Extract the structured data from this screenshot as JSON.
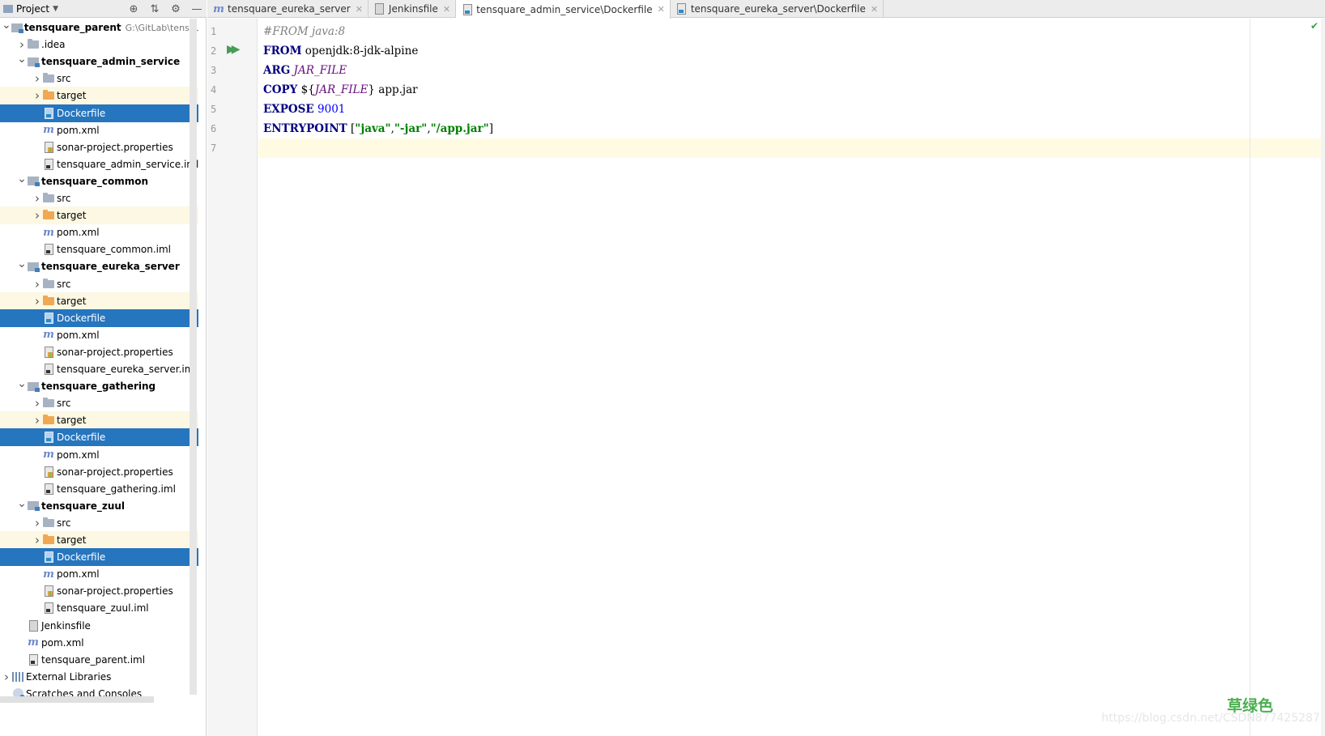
{
  "header": {
    "title": "Project"
  },
  "tree": [
    {
      "label": "tensquare_parent",
      "path": "G:\\GitLab\\tensquare_",
      "bold": true,
      "level": 0,
      "chev": "v",
      "icon": "module"
    },
    {
      "label": ".idea",
      "level": 1,
      "chev": ">",
      "icon": "folder"
    },
    {
      "label": "tensquare_admin_service",
      "bold": true,
      "level": 1,
      "chev": "v",
      "icon": "module"
    },
    {
      "label": "src",
      "level": 2,
      "chev": ">",
      "icon": "folder"
    },
    {
      "label": "target",
      "level": 2,
      "chev": ">",
      "icon": "folder-orange",
      "excluded": true
    },
    {
      "label": "Dockerfile",
      "level": 2,
      "icon": "docker",
      "selected": true
    },
    {
      "label": "pom.xml",
      "level": 2,
      "icon": "maven"
    },
    {
      "label": "sonar-project.properties",
      "level": 2,
      "icon": "props"
    },
    {
      "label": "tensquare_admin_service.iml",
      "level": 2,
      "icon": "iml"
    },
    {
      "label": "tensquare_common",
      "bold": true,
      "level": 1,
      "chev": "v",
      "icon": "module"
    },
    {
      "label": "src",
      "level": 2,
      "chev": ">",
      "icon": "folder"
    },
    {
      "label": "target",
      "level": 2,
      "chev": ">",
      "icon": "folder-orange",
      "excluded": true
    },
    {
      "label": "pom.xml",
      "level": 2,
      "icon": "maven"
    },
    {
      "label": "tensquare_common.iml",
      "level": 2,
      "icon": "iml"
    },
    {
      "label": "tensquare_eureka_server",
      "bold": true,
      "level": 1,
      "chev": "v",
      "icon": "module"
    },
    {
      "label": "src",
      "level": 2,
      "chev": ">",
      "icon": "folder"
    },
    {
      "label": "target",
      "level": 2,
      "chev": ">",
      "icon": "folder-orange",
      "excluded": true
    },
    {
      "label": "Dockerfile",
      "level": 2,
      "icon": "docker",
      "selected": true
    },
    {
      "label": "pom.xml",
      "level": 2,
      "icon": "maven"
    },
    {
      "label": "sonar-project.properties",
      "level": 2,
      "icon": "props"
    },
    {
      "label": "tensquare_eureka_server.iml",
      "level": 2,
      "icon": "iml"
    },
    {
      "label": "tensquare_gathering",
      "bold": true,
      "level": 1,
      "chev": "v",
      "icon": "module"
    },
    {
      "label": "src",
      "level": 2,
      "chev": ">",
      "icon": "folder"
    },
    {
      "label": "target",
      "level": 2,
      "chev": ">",
      "icon": "folder-orange",
      "excluded": true
    },
    {
      "label": "Dockerfile",
      "level": 2,
      "icon": "docker",
      "selected": true
    },
    {
      "label": "pom.xml",
      "level": 2,
      "icon": "maven"
    },
    {
      "label": "sonar-project.properties",
      "level": 2,
      "icon": "props"
    },
    {
      "label": "tensquare_gathering.iml",
      "level": 2,
      "icon": "iml"
    },
    {
      "label": "tensquare_zuul",
      "bold": true,
      "level": 1,
      "chev": "v",
      "icon": "module"
    },
    {
      "label": "src",
      "level": 2,
      "chev": ">",
      "icon": "folder"
    },
    {
      "label": "target",
      "level": 2,
      "chev": ">",
      "icon": "folder-orange",
      "excluded": true
    },
    {
      "label": "Dockerfile",
      "level": 2,
      "icon": "docker",
      "selected": true
    },
    {
      "label": "pom.xml",
      "level": 2,
      "icon": "maven"
    },
    {
      "label": "sonar-project.properties",
      "level": 2,
      "icon": "props"
    },
    {
      "label": "tensquare_zuul.iml",
      "level": 2,
      "icon": "iml"
    },
    {
      "label": "Jenkinsfile",
      "level": 1,
      "icon": "jenkins"
    },
    {
      "label": "pom.xml",
      "level": 1,
      "icon": "maven"
    },
    {
      "label": "tensquare_parent.iml",
      "level": 1,
      "icon": "iml"
    },
    {
      "label": "External Libraries",
      "level": 0,
      "chev": ">",
      "icon": "libs"
    },
    {
      "label": "Scratches and Consoles",
      "level": 0,
      "icon": "scratch"
    }
  ],
  "tabs": [
    {
      "label": "tensquare_eureka_server",
      "icon": "maven",
      "active": false
    },
    {
      "label": "Jenkinsfile",
      "icon": "jenkins",
      "active": false
    },
    {
      "label": "tensquare_admin_service\\Dockerfile",
      "icon": "docker",
      "active": true
    },
    {
      "label": "tensquare_eureka_server\\Dockerfile",
      "icon": "docker",
      "active": false
    }
  ],
  "editor": {
    "line_numbers": [
      "1",
      "2",
      "3",
      "4",
      "5",
      "6",
      "7"
    ],
    "lines": [
      [
        {
          "t": "#FROM java:8",
          "c": "cm"
        }
      ],
      [
        {
          "t": "FROM",
          "c": "kw"
        },
        {
          "t": " openjdk:8-jdk-alpine",
          "c": ""
        }
      ],
      [
        {
          "t": "ARG",
          "c": "kw"
        },
        {
          "t": " ",
          "c": ""
        },
        {
          "t": "JAR_FILE",
          "c": "var"
        }
      ],
      [
        {
          "t": "COPY",
          "c": "kw"
        },
        {
          "t": " ${",
          "c": ""
        },
        {
          "t": "JAR_FILE",
          "c": "var"
        },
        {
          "t": "} app.jar",
          "c": ""
        }
      ],
      [
        {
          "t": "EXPOSE",
          "c": "kw"
        },
        {
          "t": " ",
          "c": ""
        },
        {
          "t": "9001",
          "c": "num"
        }
      ],
      [
        {
          "t": "ENTRYPOINT",
          "c": "kw"
        },
        {
          "t": " [",
          "c": ""
        },
        {
          "t": "\"java\"",
          "c": "str"
        },
        {
          "t": ",",
          "c": ""
        },
        {
          "t": "\"-jar\"",
          "c": "str"
        },
        {
          "t": ",",
          "c": ""
        },
        {
          "t": "\"/app.jar\"",
          "c": "str"
        },
        {
          "t": "]",
          "c": ""
        }
      ],
      []
    ],
    "current_line": 7
  },
  "watermark": {
    "cn": "草绿色",
    "url": "https://blog.csdn.net/CSDN877425287"
  }
}
